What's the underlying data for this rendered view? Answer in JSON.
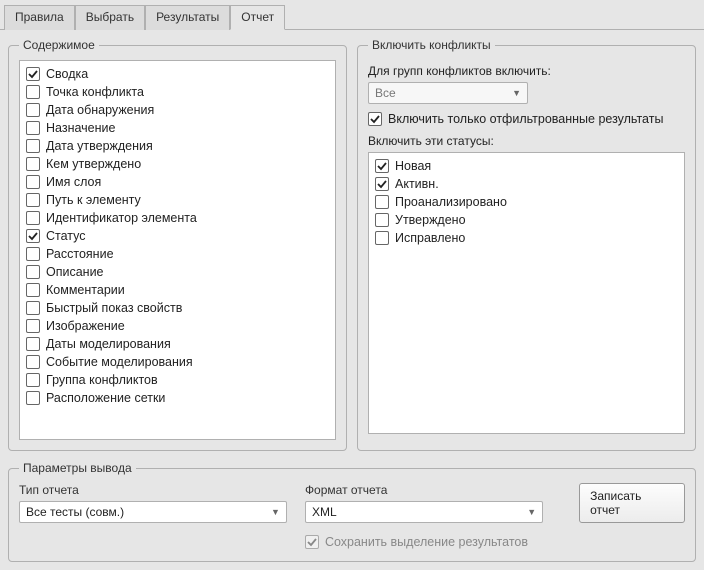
{
  "tabs": {
    "rules": "Правила",
    "select": "Выбрать",
    "results": "Результаты",
    "report": "Отчет"
  },
  "content_group": {
    "legend": "Содержимое",
    "items": [
      {
        "label": "Сводка",
        "checked": true
      },
      {
        "label": "Точка конфликта",
        "checked": false
      },
      {
        "label": "Дата обнаружения",
        "checked": false
      },
      {
        "label": "Назначение",
        "checked": false
      },
      {
        "label": "Дата утверждения",
        "checked": false
      },
      {
        "label": "Кем утверждено",
        "checked": false
      },
      {
        "label": "Имя слоя",
        "checked": false
      },
      {
        "label": "Путь к элементу",
        "checked": false
      },
      {
        "label": "Идентификатор элемента",
        "checked": false
      },
      {
        "label": "Статус",
        "checked": true
      },
      {
        "label": "Расстояние",
        "checked": false
      },
      {
        "label": "Описание",
        "checked": false
      },
      {
        "label": "Комментарии",
        "checked": false
      },
      {
        "label": "Быстрый показ свойств",
        "checked": false
      },
      {
        "label": "Изображение",
        "checked": false
      },
      {
        "label": "Даты моделирования",
        "checked": false
      },
      {
        "label": "Событие моделирования",
        "checked": false
      },
      {
        "label": "Группа конфликтов",
        "checked": false
      },
      {
        "label": "Расположение сетки",
        "checked": false
      }
    ]
  },
  "conflicts_group": {
    "legend": "Включить конфликты",
    "groups_label": "Для групп конфликтов включить:",
    "groups_value": "Все",
    "filtered_label": "Включить только отфильтрованные результаты",
    "filtered_checked": true,
    "statuses_label": "Включить эти статусы:",
    "statuses": [
      {
        "label": "Новая",
        "checked": true
      },
      {
        "label": "Активн.",
        "checked": true
      },
      {
        "label": "Проанализировано",
        "checked": false
      },
      {
        "label": "Утверждено",
        "checked": false
      },
      {
        "label": "Исправлено",
        "checked": false
      }
    ]
  },
  "output_group": {
    "legend": "Параметры вывода",
    "type_label": "Тип отчета",
    "type_value": "Все тесты (совм.)",
    "format_label": "Формат отчета",
    "format_value": "XML",
    "save_highlight_label": "Сохранить выделение результатов",
    "save_highlight_checked": true,
    "write_button": "Записать отчет"
  }
}
